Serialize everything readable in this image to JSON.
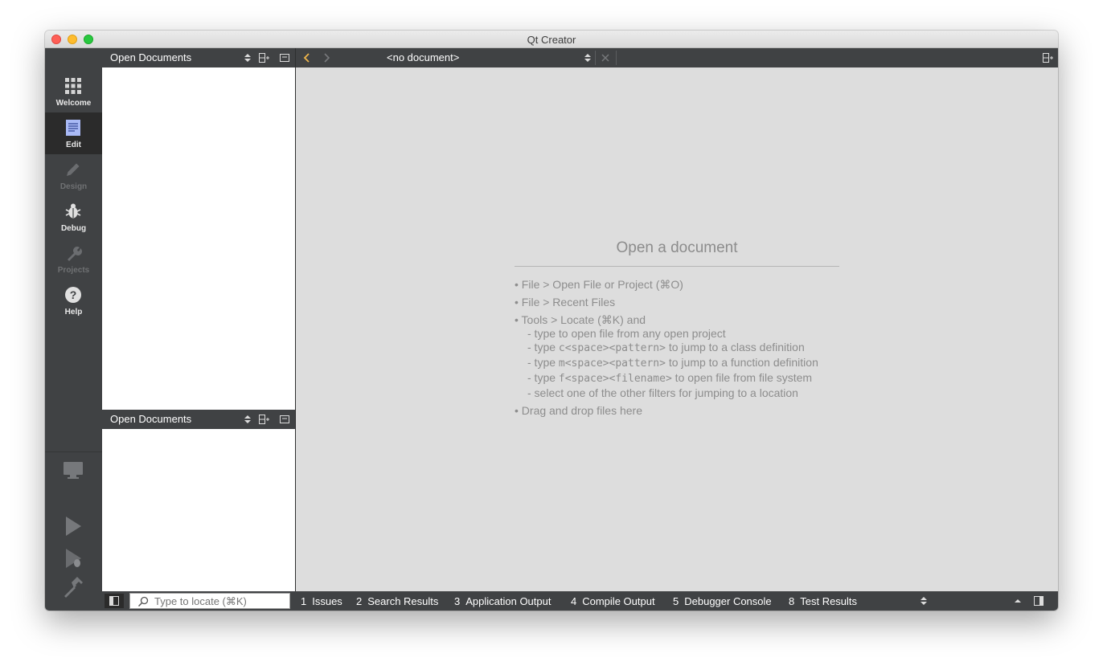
{
  "window": {
    "title": "Qt Creator"
  },
  "modes": [
    {
      "label": "Welcome",
      "icon": "grid-icon"
    },
    {
      "label": "Edit",
      "icon": "document-icon"
    },
    {
      "label": "Design",
      "icon": "pencil-icon"
    },
    {
      "label": "Debug",
      "icon": "bug-icon"
    },
    {
      "label": "Projects",
      "icon": "wrench-icon"
    },
    {
      "label": "Help",
      "icon": "help-icon"
    }
  ],
  "sidebar": {
    "top_pane": {
      "title": "Open Documents"
    },
    "bottom_pane": {
      "title": "Open Documents"
    }
  },
  "editor": {
    "document_combo": "<no document>",
    "placeholder_title": "Open a document",
    "hints": [
      "• File > Open File or Project (⌘O)",
      "• File > Recent Files",
      "• Tools > Locate (⌘K) and"
    ],
    "sub_hints": {
      "any_project": "- type to open file from any open project",
      "class_pre": "- type ",
      "class_code": "c<space><pattern>",
      "class_post": " to jump to a class definition",
      "func_pre": "- type ",
      "func_code": "m<space><pattern>",
      "func_post": " to jump to a function definition",
      "file_pre": "- type ",
      "file_code": "f<space><filename>",
      "file_post": " to open file from file system",
      "filters": "- select one of the other filters for jumping to a location"
    },
    "drag_hint": "• Drag and drop files here"
  },
  "locator": {
    "placeholder": "Type to locate (⌘K)"
  },
  "output_tabs": [
    {
      "num": "1",
      "label": "Issues"
    },
    {
      "num": "2",
      "label": "Search Results"
    },
    {
      "num": "3",
      "label": "Application Output"
    },
    {
      "num": "4",
      "label": "Compile Output"
    },
    {
      "num": "5",
      "label": "Debugger Console"
    },
    {
      "num": "8",
      "label": "Test Results"
    }
  ],
  "colors": {
    "accent": "#f0b64b",
    "panel": "#404244",
    "editor_bg": "#dddddd"
  }
}
